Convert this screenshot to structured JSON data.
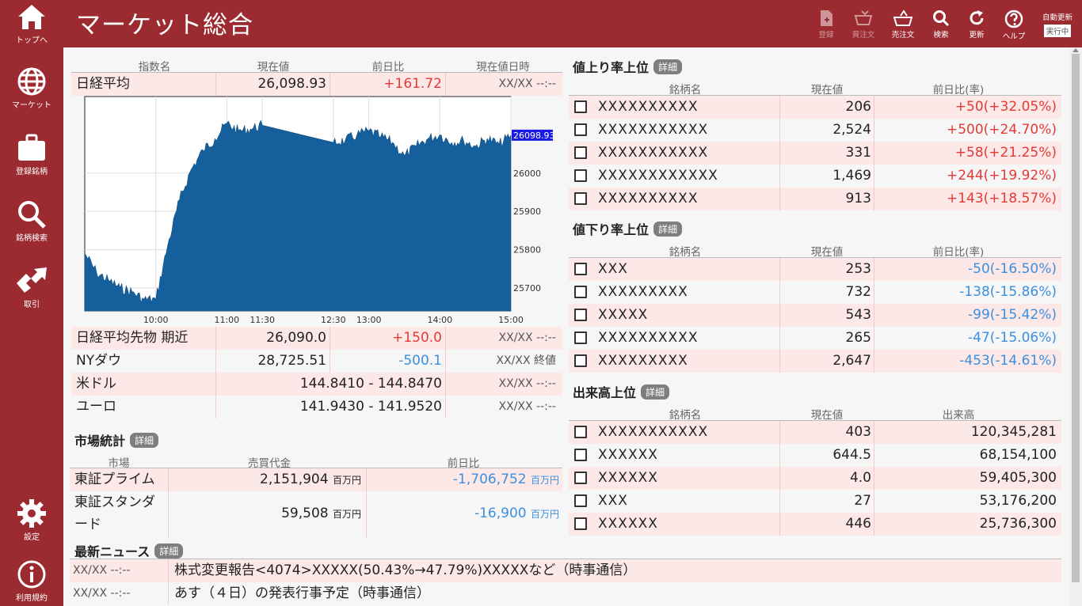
{
  "app": {
    "title": "マーケット総合"
  },
  "sidebar": [
    {
      "label": "トップへ",
      "icon": "home-icon"
    },
    {
      "label": "マーケット",
      "icon": "globe-icon"
    },
    {
      "label": "登録銘柄",
      "icon": "briefcase-icon"
    },
    {
      "label": "銘柄検索",
      "icon": "search-icon"
    },
    {
      "label": "取引",
      "icon": "trade-icon"
    },
    {
      "label": "設定",
      "icon": "gear-icon"
    },
    {
      "label": "利用規約",
      "icon": "info-icon"
    }
  ],
  "toolbar": [
    {
      "label": "登録",
      "icon": "register-icon",
      "disabled": true
    },
    {
      "label": "買注文",
      "icon": "buy-cart-icon",
      "disabled": true
    },
    {
      "label": "売注文",
      "icon": "sell-cart-icon",
      "disabled": false
    },
    {
      "label": "検索",
      "icon": "search-icon",
      "disabled": false
    },
    {
      "label": "更新",
      "icon": "refresh-icon",
      "disabled": false
    },
    {
      "label": "ヘルプ",
      "icon": "help-icon",
      "disabled": false
    }
  ],
  "auto_update": {
    "label": "自動更新",
    "status": "実行中"
  },
  "indices": {
    "headers": [
      "指数名",
      "現在値",
      "前日比",
      "現在値日時"
    ],
    "rows": [
      {
        "name": "日経平均",
        "value": "26,098.93",
        "change": "+161.72",
        "time": "XX/XX --:--"
      },
      {
        "name": "日経平均先物 期近",
        "value": "26,090.0",
        "change": "+150.0",
        "time": "XX/XX --:--"
      },
      {
        "name": "NYダウ",
        "value": "28,725.51",
        "change": "-500.1",
        "time": "XX/XX 終値"
      },
      {
        "name": "米ドル",
        "value": "144.8410 - 144.8470",
        "change": "",
        "time": "XX/XX --:--"
      },
      {
        "name": "ユーロ",
        "value": "141.9430 - 141.9520",
        "change": "",
        "time": "XX/XX --:--"
      }
    ]
  },
  "chart_data": {
    "type": "area",
    "current_label": "26098.93",
    "x_ticks": [
      "10:00",
      "11:00",
      "11:30",
      "12:30",
      "13:00",
      "14:00",
      "15:00"
    ],
    "y_ticks": [
      26000,
      25900,
      25800,
      25700
    ],
    "ylim": [
      25640,
      26200
    ],
    "x": [
      "09:00",
      "09:10",
      "09:20",
      "09:30",
      "09:40",
      "09:50",
      "10:00",
      "10:10",
      "10:20",
      "10:30",
      "10:40",
      "10:50",
      "11:00",
      "11:10",
      "11:20",
      "11:30",
      "12:30",
      "12:40",
      "12:50",
      "13:00",
      "13:10",
      "13:20",
      "13:30",
      "13:40",
      "13:50",
      "14:00",
      "14:10",
      "14:20",
      "14:30",
      "14:40",
      "14:50",
      "15:00"
    ],
    "values": [
      25790,
      25740,
      25720,
      25700,
      25690,
      25670,
      25670,
      25810,
      25930,
      26010,
      26060,
      26090,
      26130,
      26110,
      26115,
      26125,
      26080,
      26085,
      26100,
      26110,
      26095,
      26080,
      26045,
      26070,
      26090,
      26100,
      26080,
      26085,
      26070,
      26090,
      26075,
      26099
    ]
  },
  "gainers": {
    "title": "値上り率上位",
    "detail": "詳細",
    "headers": [
      "銘柄名",
      "現在値",
      "前日比(率)"
    ],
    "rows": [
      {
        "name": "XXXXXXXXXX",
        "price": "206",
        "change": "+50(+32.05%)"
      },
      {
        "name": "XXXXXXXXXXX",
        "price": "2,524",
        "change": "+500(+24.70%)"
      },
      {
        "name": "XXXXXXXXXXX",
        "price": "331",
        "change": "+58(+21.25%)"
      },
      {
        "name": "XXXXXXXXXXXX",
        "price": "1,469",
        "change": "+244(+19.92%)"
      },
      {
        "name": "XXXXXXXXXX",
        "price": "913",
        "change": "+143(+18.57%)"
      }
    ]
  },
  "losers": {
    "title": "値下り率上位",
    "detail": "詳細",
    "headers": [
      "銘柄名",
      "現在値",
      "前日比(率)"
    ],
    "rows": [
      {
        "name": "XXX",
        "price": "253",
        "change": "-50(-16.50%)"
      },
      {
        "name": "XXXXXXXXX",
        "price": "732",
        "change": "-138(-15.86%)"
      },
      {
        "name": "XXXXX",
        "price": "543",
        "change": "-99(-15.42%)"
      },
      {
        "name": "XXXXXXXXXX",
        "price": "265",
        "change": "-47(-15.06%)"
      },
      {
        "name": "XXXXXXXXX",
        "price": "2,647",
        "change": "-453(-14.61%)"
      }
    ]
  },
  "volume": {
    "title": "出来高上位",
    "detail": "詳細",
    "headers": [
      "銘柄名",
      "現在値",
      "出来高"
    ],
    "rows": [
      {
        "name": "XXXXXXXXXXX",
        "price": "403",
        "volume": "120,345,281"
      },
      {
        "name": "XXXXXX",
        "price": "644.5",
        "volume": "68,154,100"
      },
      {
        "name": "XXXXXX",
        "price": "4.0",
        "volume": "59,405,300"
      },
      {
        "name": "XXX",
        "price": "27",
        "volume": "53,176,200"
      },
      {
        "name": "XXXXXX",
        "price": "446",
        "volume": "25,736,300"
      }
    ]
  },
  "market_stats": {
    "title": "市場統計",
    "detail": "詳細",
    "headers": [
      "市場",
      "売買代金",
      "前日比"
    ],
    "unit": "百万円",
    "rows": [
      {
        "market": "東証プライム",
        "amount": "2,151,904",
        "change": "-1,706,752"
      },
      {
        "market": "東証スタンダード",
        "market_line1": "東証スタンダ",
        "market_line2": "ード",
        "amount": "59,508",
        "change": "-16,900"
      }
    ]
  },
  "news": {
    "title": "最新ニュース",
    "detail": "詳細",
    "rows": [
      {
        "time": "XX/XX --:--",
        "headline": "株式変更報告<4074>XXXXX(50.43%→47.79%)XXXXXなど（時事通信）"
      },
      {
        "time": "XX/XX --:--",
        "headline": "あす（４日）の発表行事予定（時事通信）"
      }
    ]
  }
}
